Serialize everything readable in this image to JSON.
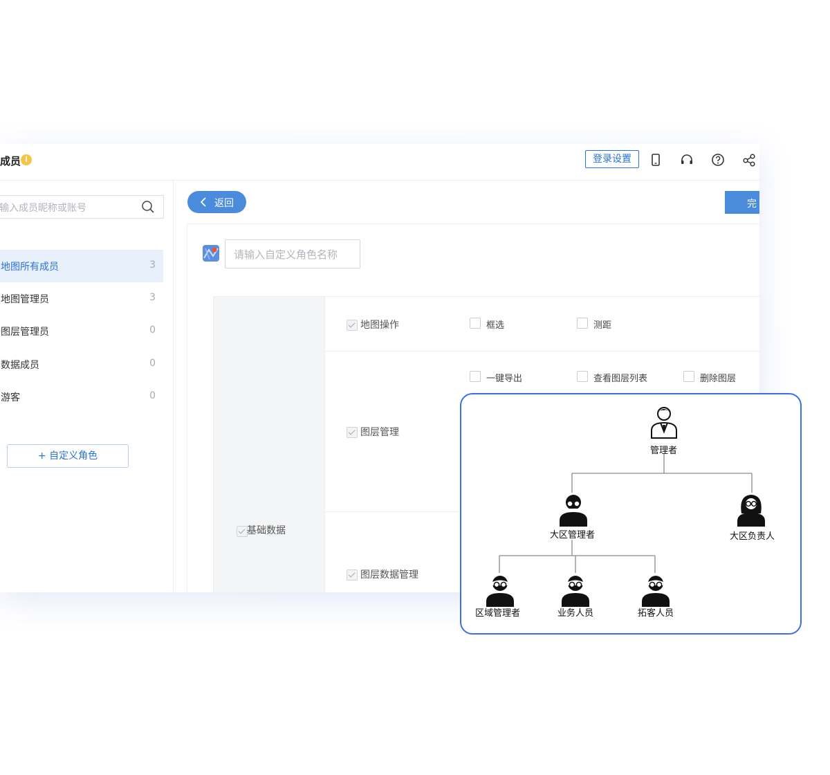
{
  "header": {
    "title": "成员",
    "login_settings_label": "登录设置"
  },
  "sidebar": {
    "search_placeholder": "输入成员昵称或账号",
    "items": [
      {
        "label": "地图所有成员",
        "count": "3"
      },
      {
        "label": "地图管理员",
        "count": "3"
      },
      {
        "label": "图层管理员",
        "count": "0"
      },
      {
        "label": "数据成员",
        "count": "0"
      },
      {
        "label": "游客",
        "count": "0"
      }
    ],
    "add_role_label": "+ 自定义角色"
  },
  "content": {
    "back_label": "返回",
    "done_label": "完",
    "role_name_placeholder": "请输入自定义角色名称",
    "category_label": "基础数据",
    "groups": [
      {
        "label": "地图操作",
        "permissions": [
          "框选",
          "测距"
        ]
      },
      {
        "label": "图层管理",
        "permissions": [
          "一键导出",
          "查看图层列表",
          "删除图层"
        ]
      },
      {
        "label": "图层数据管理",
        "permissions": []
      }
    ]
  },
  "org_chart": {
    "root": "管理者",
    "level1": [
      "大区管理者",
      "大区负责人"
    ],
    "level2": [
      "区域管理者",
      "业务人员",
      "拓客人员"
    ]
  },
  "colors": {
    "accent": "#4a8bdc",
    "link_blue": "#2a73d9",
    "active_bg": "#e8f0fb",
    "org_border": "#3b6ee8",
    "info_badge": "#f5c644"
  }
}
